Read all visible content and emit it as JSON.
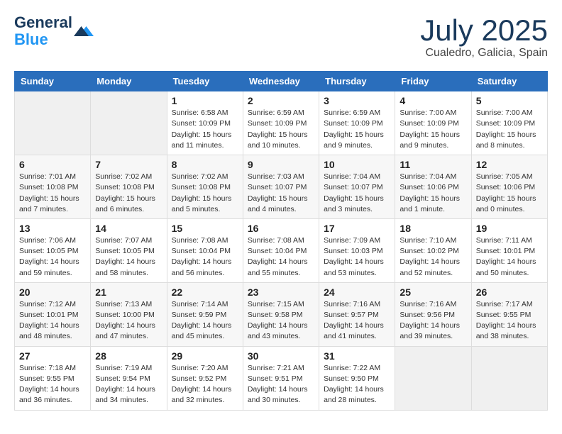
{
  "header": {
    "logo_line1": "General",
    "logo_line2": "Blue",
    "month": "July 2025",
    "location": "Cualedro, Galicia, Spain"
  },
  "weekdays": [
    "Sunday",
    "Monday",
    "Tuesday",
    "Wednesday",
    "Thursday",
    "Friday",
    "Saturday"
  ],
  "weeks": [
    [
      {
        "day": "",
        "info": ""
      },
      {
        "day": "",
        "info": ""
      },
      {
        "day": "1",
        "info": "Sunrise: 6:58 AM\nSunset: 10:09 PM\nDaylight: 15 hours\nand 11 minutes."
      },
      {
        "day": "2",
        "info": "Sunrise: 6:59 AM\nSunset: 10:09 PM\nDaylight: 15 hours\nand 10 minutes."
      },
      {
        "day": "3",
        "info": "Sunrise: 6:59 AM\nSunset: 10:09 PM\nDaylight: 15 hours\nand 9 minutes."
      },
      {
        "day": "4",
        "info": "Sunrise: 7:00 AM\nSunset: 10:09 PM\nDaylight: 15 hours\nand 9 minutes."
      },
      {
        "day": "5",
        "info": "Sunrise: 7:00 AM\nSunset: 10:09 PM\nDaylight: 15 hours\nand 8 minutes."
      }
    ],
    [
      {
        "day": "6",
        "info": "Sunrise: 7:01 AM\nSunset: 10:08 PM\nDaylight: 15 hours\nand 7 minutes."
      },
      {
        "day": "7",
        "info": "Sunrise: 7:02 AM\nSunset: 10:08 PM\nDaylight: 15 hours\nand 6 minutes."
      },
      {
        "day": "8",
        "info": "Sunrise: 7:02 AM\nSunset: 10:08 PM\nDaylight: 15 hours\nand 5 minutes."
      },
      {
        "day": "9",
        "info": "Sunrise: 7:03 AM\nSunset: 10:07 PM\nDaylight: 15 hours\nand 4 minutes."
      },
      {
        "day": "10",
        "info": "Sunrise: 7:04 AM\nSunset: 10:07 PM\nDaylight: 15 hours\nand 3 minutes."
      },
      {
        "day": "11",
        "info": "Sunrise: 7:04 AM\nSunset: 10:06 PM\nDaylight: 15 hours\nand 1 minute."
      },
      {
        "day": "12",
        "info": "Sunrise: 7:05 AM\nSunset: 10:06 PM\nDaylight: 15 hours\nand 0 minutes."
      }
    ],
    [
      {
        "day": "13",
        "info": "Sunrise: 7:06 AM\nSunset: 10:05 PM\nDaylight: 14 hours\nand 59 minutes."
      },
      {
        "day": "14",
        "info": "Sunrise: 7:07 AM\nSunset: 10:05 PM\nDaylight: 14 hours\nand 58 minutes."
      },
      {
        "day": "15",
        "info": "Sunrise: 7:08 AM\nSunset: 10:04 PM\nDaylight: 14 hours\nand 56 minutes."
      },
      {
        "day": "16",
        "info": "Sunrise: 7:08 AM\nSunset: 10:04 PM\nDaylight: 14 hours\nand 55 minutes."
      },
      {
        "day": "17",
        "info": "Sunrise: 7:09 AM\nSunset: 10:03 PM\nDaylight: 14 hours\nand 53 minutes."
      },
      {
        "day": "18",
        "info": "Sunrise: 7:10 AM\nSunset: 10:02 PM\nDaylight: 14 hours\nand 52 minutes."
      },
      {
        "day": "19",
        "info": "Sunrise: 7:11 AM\nSunset: 10:01 PM\nDaylight: 14 hours\nand 50 minutes."
      }
    ],
    [
      {
        "day": "20",
        "info": "Sunrise: 7:12 AM\nSunset: 10:01 PM\nDaylight: 14 hours\nand 48 minutes."
      },
      {
        "day": "21",
        "info": "Sunrise: 7:13 AM\nSunset: 10:00 PM\nDaylight: 14 hours\nand 47 minutes."
      },
      {
        "day": "22",
        "info": "Sunrise: 7:14 AM\nSunset: 9:59 PM\nDaylight: 14 hours\nand 45 minutes."
      },
      {
        "day": "23",
        "info": "Sunrise: 7:15 AM\nSunset: 9:58 PM\nDaylight: 14 hours\nand 43 minutes."
      },
      {
        "day": "24",
        "info": "Sunrise: 7:16 AM\nSunset: 9:57 PM\nDaylight: 14 hours\nand 41 minutes."
      },
      {
        "day": "25",
        "info": "Sunrise: 7:16 AM\nSunset: 9:56 PM\nDaylight: 14 hours\nand 39 minutes."
      },
      {
        "day": "26",
        "info": "Sunrise: 7:17 AM\nSunset: 9:55 PM\nDaylight: 14 hours\nand 38 minutes."
      }
    ],
    [
      {
        "day": "27",
        "info": "Sunrise: 7:18 AM\nSunset: 9:55 PM\nDaylight: 14 hours\nand 36 minutes."
      },
      {
        "day": "28",
        "info": "Sunrise: 7:19 AM\nSunset: 9:54 PM\nDaylight: 14 hours\nand 34 minutes."
      },
      {
        "day": "29",
        "info": "Sunrise: 7:20 AM\nSunset: 9:52 PM\nDaylight: 14 hours\nand 32 minutes."
      },
      {
        "day": "30",
        "info": "Sunrise: 7:21 AM\nSunset: 9:51 PM\nDaylight: 14 hours\nand 30 minutes."
      },
      {
        "day": "31",
        "info": "Sunrise: 7:22 AM\nSunset: 9:50 PM\nDaylight: 14 hours\nand 28 minutes."
      },
      {
        "day": "",
        "info": ""
      },
      {
        "day": "",
        "info": ""
      }
    ]
  ]
}
